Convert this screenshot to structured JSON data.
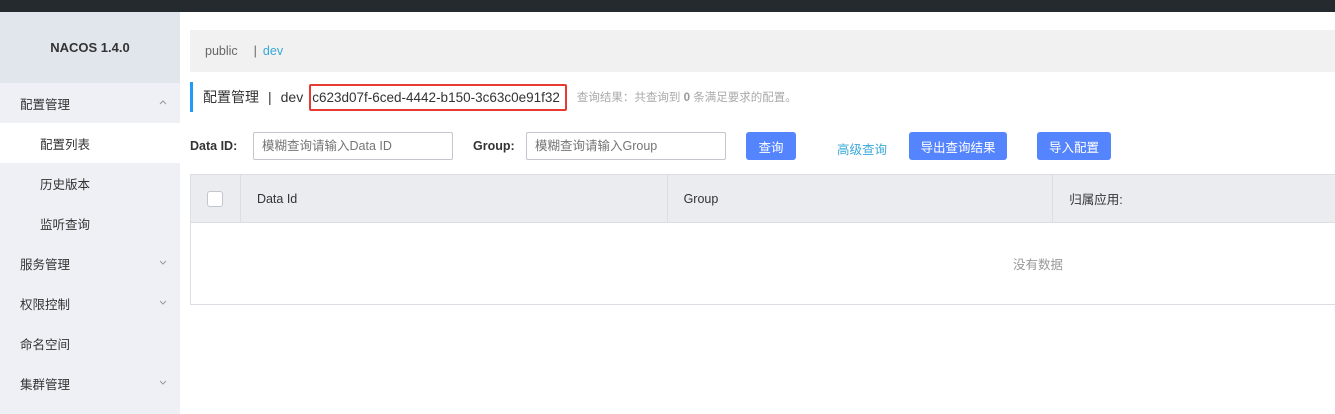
{
  "sidebar": {
    "brand": "NACOS 1.4.0",
    "items": [
      {
        "label": "配置管理",
        "chevron": "up"
      },
      {
        "label": "配置列表"
      },
      {
        "label": "历史版本"
      },
      {
        "label": "监听查询"
      },
      {
        "label": "服务管理",
        "chevron": "down"
      },
      {
        "label": "权限控制",
        "chevron": "down"
      },
      {
        "label": "命名空间"
      },
      {
        "label": "集群管理",
        "chevron": "down"
      }
    ]
  },
  "namespace_bar": {
    "public": "public",
    "separator": "|",
    "current": "dev"
  },
  "header": {
    "title": "配置管理",
    "separator": "|",
    "namespace_name": "dev",
    "namespace_id": "c623d07f-6ced-4442-b150-3c63c0e91f32",
    "result_note_prefix": "查询结果：共查询到",
    "result_count": "0",
    "result_note_suffix": "条满足要求的配置。"
  },
  "search": {
    "data_id_label": "Data ID:",
    "data_id_placeholder": "模糊查询请输入Data ID",
    "group_label": "Group:",
    "group_placeholder": "模糊查询请输入Group",
    "query_button": "查询",
    "advanced_link": "高级查询",
    "export_button": "导出查询结果",
    "import_button": "导入配置"
  },
  "table": {
    "columns": [
      "Data Id",
      "Group",
      "归属应用:"
    ],
    "empty_text": "没有数据"
  },
  "colors": {
    "accent": "#5584ff",
    "highlight_box": "#e63a32",
    "link": "#39a8da"
  }
}
